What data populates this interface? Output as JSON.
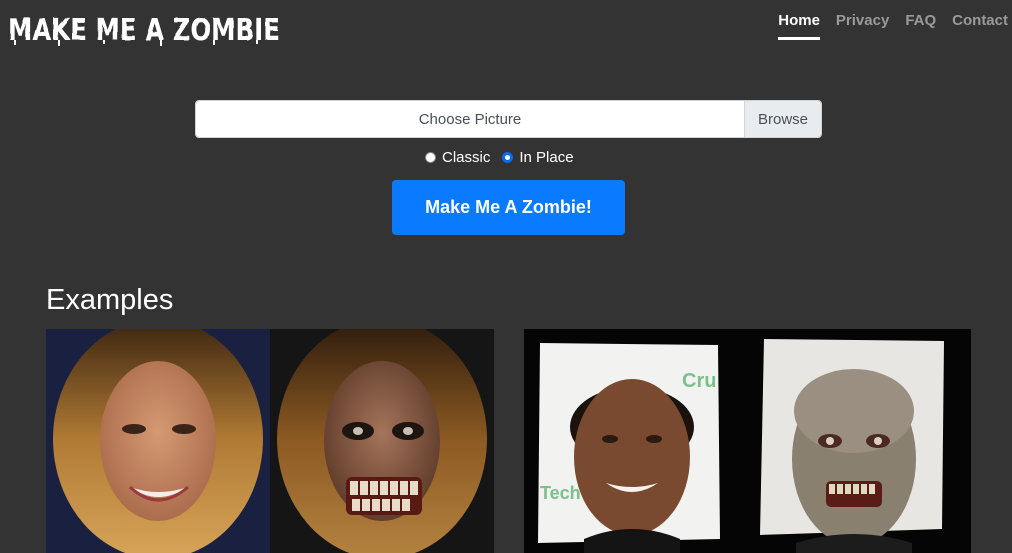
{
  "header": {
    "logo_text": "MAKE ME A ZOMBIE",
    "nav": [
      {
        "label": "Home",
        "active": true
      },
      {
        "label": "Privacy",
        "active": false
      },
      {
        "label": "FAQ",
        "active": false
      },
      {
        "label": "Contact",
        "active": false
      }
    ]
  },
  "upload": {
    "file_label": "Choose Picture",
    "browse_label": "Browse"
  },
  "mode": {
    "options": [
      {
        "label": "Classic",
        "checked": false
      },
      {
        "label": "In Place",
        "checked": true
      }
    ]
  },
  "submit_label": "Make Me A Zombie!",
  "examples": {
    "heading": "Examples",
    "sign_text_1": "Cru",
    "sign_text_2": "Tech"
  },
  "colors": {
    "background": "#333333",
    "accent": "#0a7bff"
  }
}
